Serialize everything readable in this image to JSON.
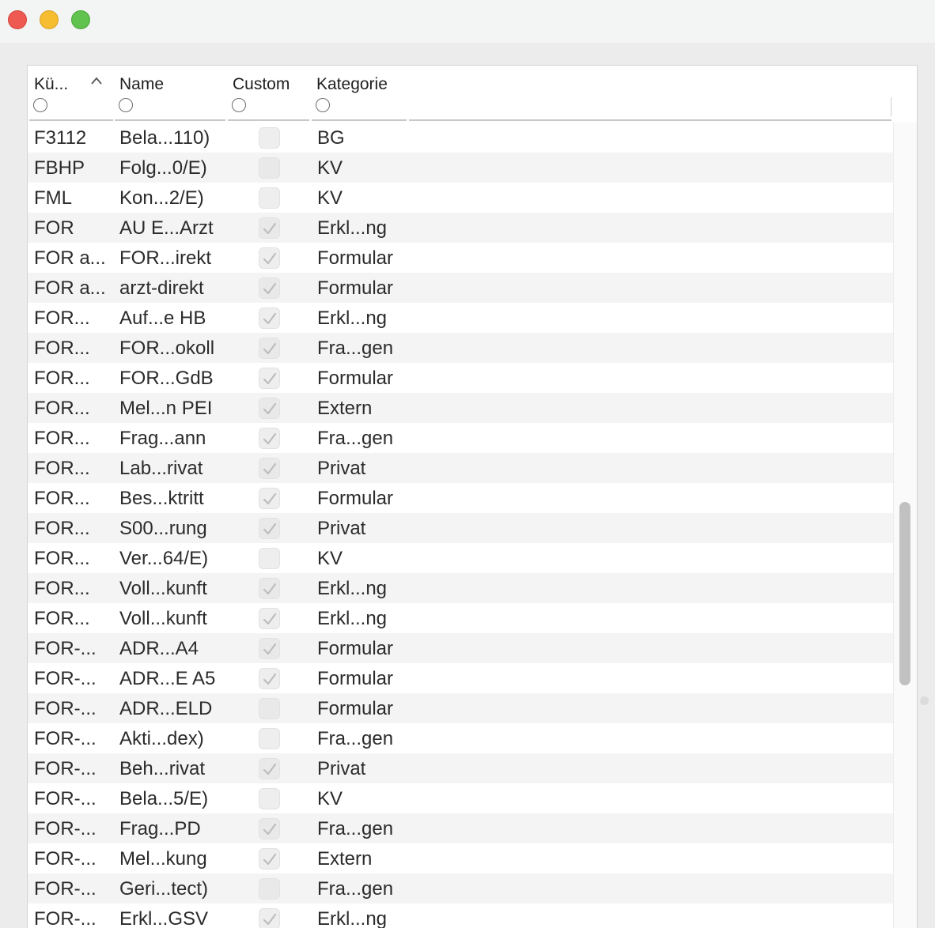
{
  "window": {
    "buttons": {
      "close": "close-icon",
      "minimize": "minimize-icon",
      "zoom": "zoom-icon"
    }
  },
  "table": {
    "sort_icon": "chevron-up-icon",
    "columns": [
      {
        "key": "code",
        "label": "Kü..."
      },
      {
        "key": "name",
        "label": "Name"
      },
      {
        "key": "custom",
        "label": "Custom"
      },
      {
        "key": "category",
        "label": "Kategorie"
      }
    ],
    "rows": [
      {
        "code": "F3112",
        "name": "Bela...110)",
        "custom": false,
        "category": "BG"
      },
      {
        "code": "FBHP",
        "name": "Folg...0/E)",
        "custom": false,
        "category": "KV"
      },
      {
        "code": "FML",
        "name": "Kon...2/E)",
        "custom": false,
        "category": "KV"
      },
      {
        "code": "FOR",
        "name": "AU E...Arzt",
        "custom": true,
        "category": "Erkl...ng"
      },
      {
        "code": "FOR a...",
        "name": "FOR...irekt",
        "custom": true,
        "category": "Formular"
      },
      {
        "code": "FOR a...",
        "name": "arzt-direkt",
        "custom": true,
        "category": "Formular"
      },
      {
        "code": "FOR...",
        "name": "Auf...e HB",
        "custom": true,
        "category": "Erkl...ng"
      },
      {
        "code": "FOR...",
        "name": "FOR...okoll",
        "custom": true,
        "category": "Fra...gen"
      },
      {
        "code": "FOR...",
        "name": "FOR...GdB",
        "custom": true,
        "category": "Formular"
      },
      {
        "code": "FOR...",
        "name": "Mel...n PEI",
        "custom": true,
        "category": "Extern"
      },
      {
        "code": "FOR...",
        "name": "Frag...ann",
        "custom": true,
        "category": "Fra...gen"
      },
      {
        "code": "FOR...",
        "name": "Lab...rivat",
        "custom": true,
        "category": "Privat"
      },
      {
        "code": "FOR...",
        "name": "Bes...ktritt",
        "custom": true,
        "category": "Formular"
      },
      {
        "code": "FOR...",
        "name": "S00...rung",
        "custom": true,
        "category": "Privat"
      },
      {
        "code": "FOR...",
        "name": "Ver...64/E)",
        "custom": false,
        "category": "KV"
      },
      {
        "code": "FOR...",
        "name": "Voll...kunft",
        "custom": true,
        "category": "Erkl...ng"
      },
      {
        "code": "FOR...",
        "name": "Voll...kunft",
        "custom": true,
        "category": "Erkl...ng"
      },
      {
        "code": "FOR-...",
        "name": "ADR...A4",
        "custom": true,
        "category": "Formular"
      },
      {
        "code": "FOR-...",
        "name": "ADR...E A5",
        "custom": true,
        "category": "Formular"
      },
      {
        "code": "FOR-...",
        "name": "ADR...ELD",
        "custom": false,
        "category": "Formular"
      },
      {
        "code": "FOR-...",
        "name": "Akti...dex)",
        "custom": false,
        "category": "Fra...gen"
      },
      {
        "code": "FOR-...",
        "name": "Beh...rivat",
        "custom": true,
        "category": "Privat"
      },
      {
        "code": "FOR-...",
        "name": "Bela...5/E)",
        "custom": false,
        "category": "KV"
      },
      {
        "code": "FOR-...",
        "name": "Frag...PD",
        "custom": true,
        "category": "Fra...gen"
      },
      {
        "code": "FOR-...",
        "name": "Mel...kung",
        "custom": true,
        "category": "Extern"
      },
      {
        "code": "FOR-...",
        "name": "Geri...tect)",
        "custom": false,
        "category": "Fra...gen"
      },
      {
        "code": "FOR-...",
        "name": "Erkl...GSV",
        "custom": true,
        "category": "Erkl...ng"
      }
    ]
  }
}
